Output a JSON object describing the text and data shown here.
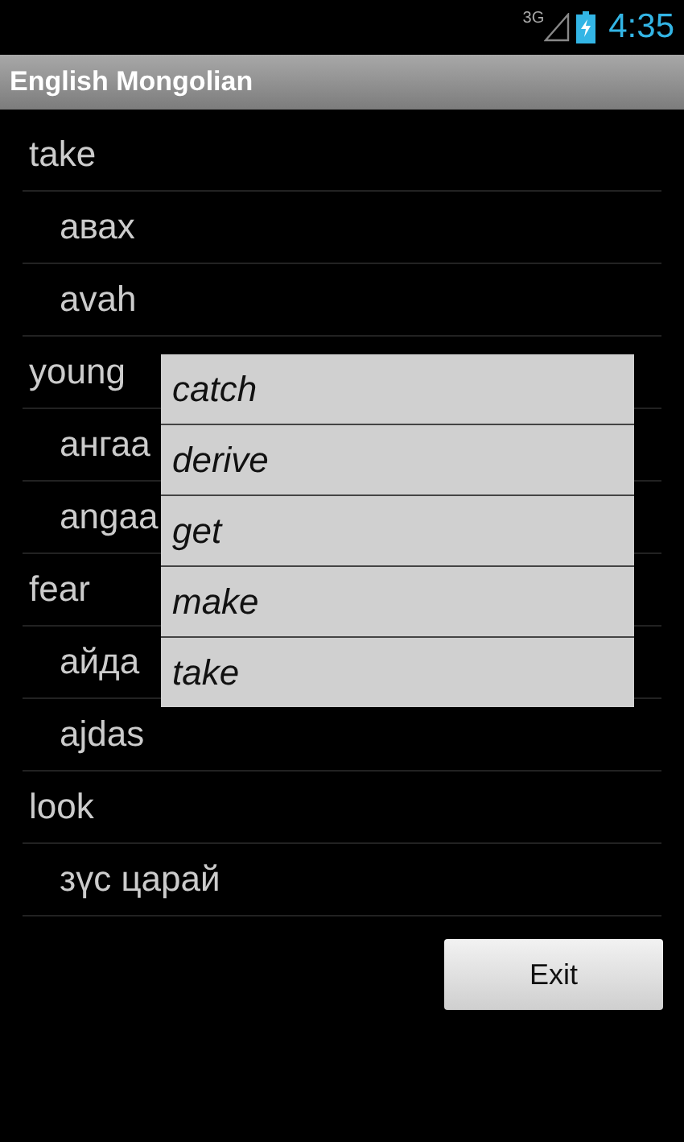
{
  "status_bar": {
    "network": "3G",
    "time": "4:35"
  },
  "title_bar": {
    "title": "English Mongolian"
  },
  "entries": [
    {
      "kind": "word",
      "text": "take"
    },
    {
      "kind": "translation",
      "text": "авах"
    },
    {
      "kind": "translation",
      "text": "avah"
    },
    {
      "kind": "word",
      "text": "young"
    },
    {
      "kind": "translation",
      "text": "ангаа"
    },
    {
      "kind": "translation",
      "text": "angaa"
    },
    {
      "kind": "word",
      "text": "fear"
    },
    {
      "kind": "translation",
      "text": "айда"
    },
    {
      "kind": "translation",
      "text": "ajdas"
    },
    {
      "kind": "word",
      "text": "look"
    },
    {
      "kind": "translation",
      "text": "зүс царай"
    }
  ],
  "popup_menu": [
    "catch",
    "derive",
    "get",
    "make",
    "take"
  ],
  "exit_button": "Exit"
}
